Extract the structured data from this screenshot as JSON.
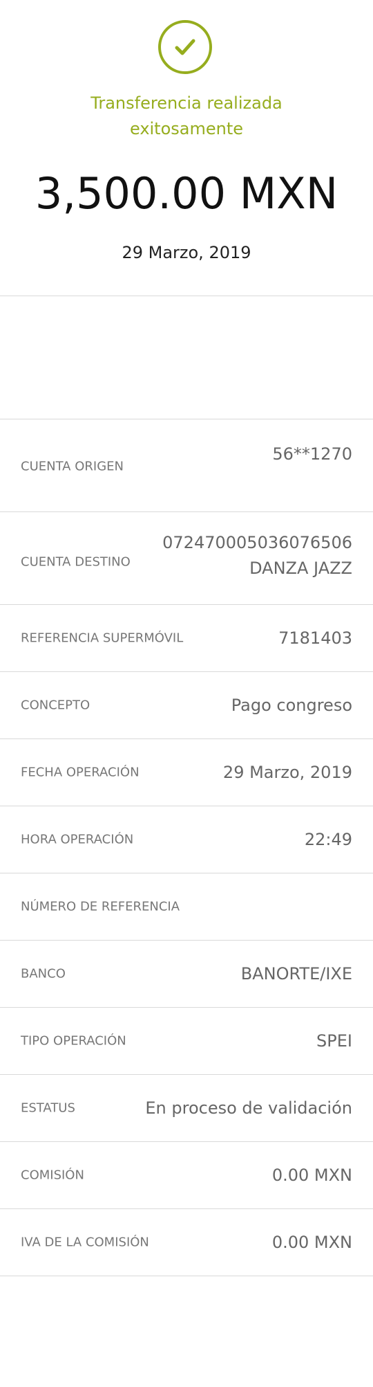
{
  "header": {
    "success_line1": "Transferencia realizada",
    "success_line2": "exitosamente",
    "amount": "3,500.00 MXN",
    "date": "29 Marzo, 2019"
  },
  "details": [
    {
      "label": "CUENTA ORIGEN",
      "value": "56**1270"
    },
    {
      "label": "CUENTA DESTINO",
      "value_line1": "072470005036076506",
      "value_line2": "DANZA JAZZ"
    },
    {
      "label": "REFERENCIA SUPERMÓVIL",
      "value": "7181403"
    },
    {
      "label": "CONCEPTO",
      "value": "Pago congreso"
    },
    {
      "label": "FECHA OPERACIÓN",
      "value": "29 Marzo, 2019"
    },
    {
      "label": "HORA OPERACIÓN",
      "value": "22:49"
    },
    {
      "label": "NÚMERO DE REFERENCIA",
      "value": ""
    },
    {
      "label": "BANCO",
      "value": "BANORTE/IXE"
    },
    {
      "label": "TIPO OPERACIÓN",
      "value": "SPEI"
    },
    {
      "label": "ESTATUS",
      "value": "En proceso de validación"
    },
    {
      "label": "COMISIÓN",
      "value": "0.00 MXN"
    },
    {
      "label": "IVA DE LA COMISIÓN",
      "value": "0.00 MXN"
    }
  ],
  "colors": {
    "accent": "#96ad1e",
    "divider": "#d9d9d9",
    "label": "#777777",
    "value": "#666666"
  },
  "icons": {
    "success": "check-circle-icon"
  }
}
